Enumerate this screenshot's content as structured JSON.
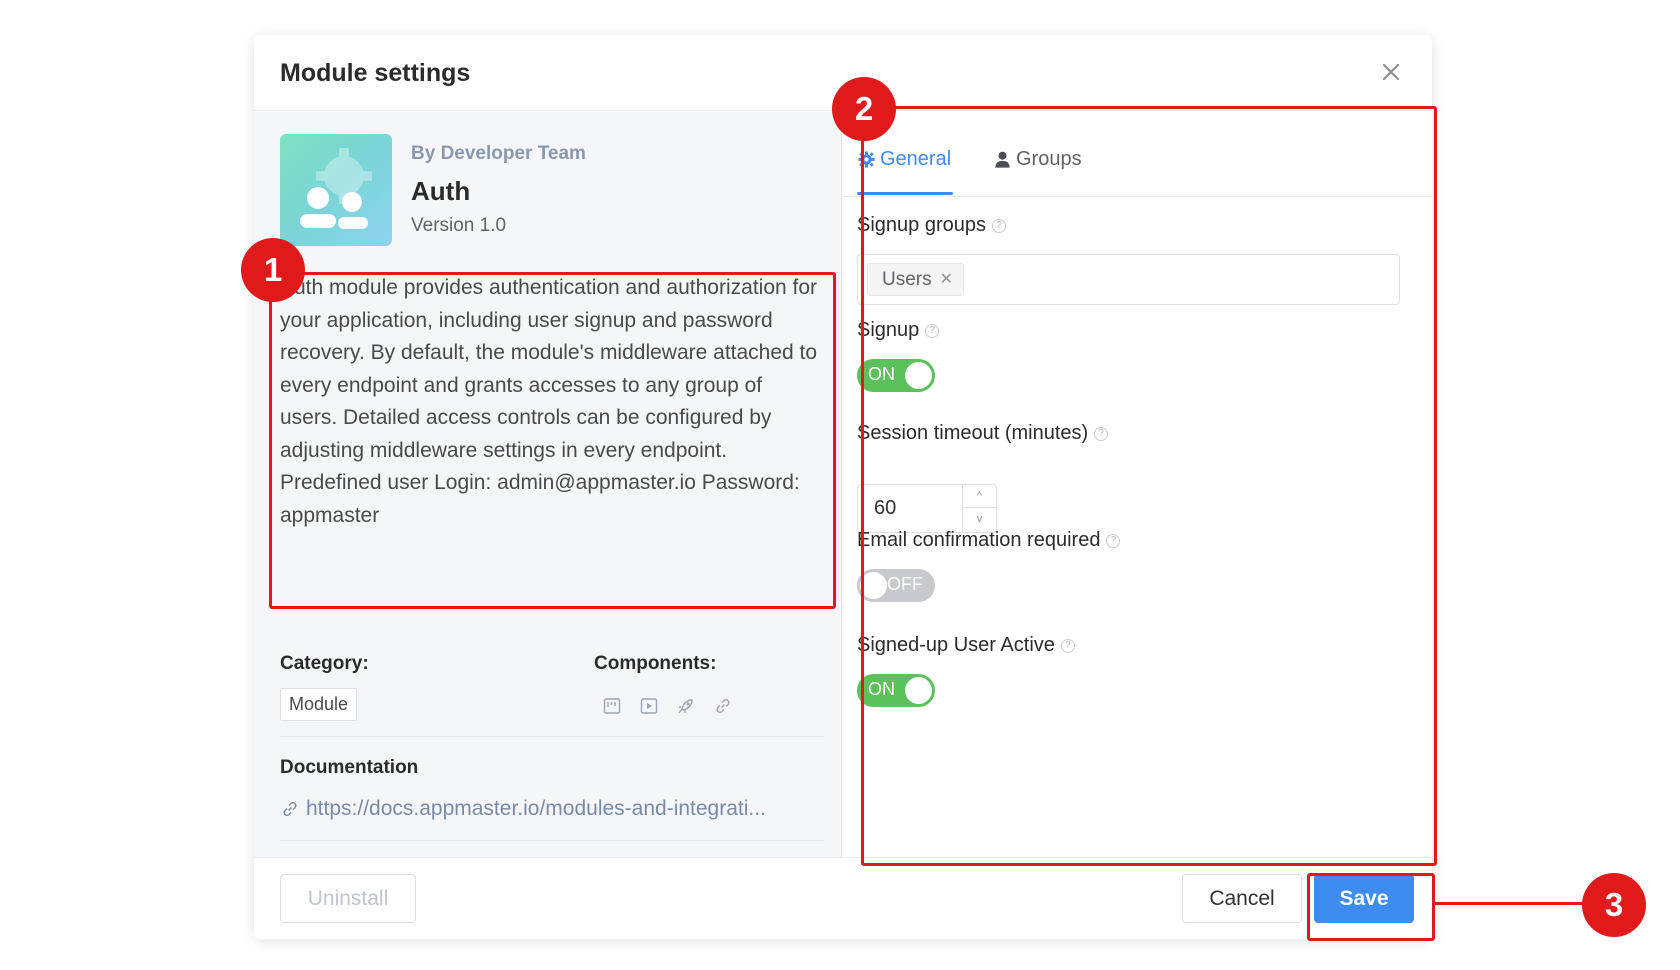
{
  "dialog": {
    "title": "Module settings"
  },
  "module": {
    "author": "By Developer Team",
    "name": "Auth",
    "version": "Version 1.0",
    "description": "Auth module provides authentication and authorization for your application, including user signup and password recovery. By default, the module's middleware attached to every endpoint and grants accesses to any group of users. Detailed access controls can be configured by adjusting middleware settings in every endpoint. Predefined user Login: admin@appmaster.io Password: appmaster",
    "category_label": "Category:",
    "category_value": "Module",
    "components_label": "Components:",
    "component_icons": [
      "board-icon",
      "play-icon",
      "rocket-icon",
      "link-icon"
    ],
    "documentation_label": "Documentation",
    "documentation_link": "https://docs.appmaster.io/modules-and-integrati..."
  },
  "tabs": [
    {
      "label": "General",
      "icon": "gear-icon",
      "active": true
    },
    {
      "label": "Groups",
      "icon": "user-icon",
      "active": false
    }
  ],
  "settings": {
    "signup_groups_label": "Signup groups",
    "signup_groups": [
      "Users"
    ],
    "signup_label": "Signup",
    "signup_state": "ON",
    "session_timeout_label": "Session timeout (minutes)",
    "session_timeout_value": "60",
    "email_confirmation_label": "Email confirmation required",
    "email_confirmation_state": "OFF",
    "user_active_label": "Signed-up User Active",
    "user_active_state": "ON"
  },
  "footer": {
    "uninstall_label": "Uninstall",
    "cancel_label": "Cancel",
    "save_label": "Save"
  },
  "annotations": {
    "badge_1": "1",
    "badge_2": "2",
    "badge_3": "3",
    "color": "#e01a1a"
  },
  "colors": {
    "accent": "#3f8cf0",
    "toggle_on": "#5cc15a",
    "toggle_off": "#c7c9ce"
  }
}
